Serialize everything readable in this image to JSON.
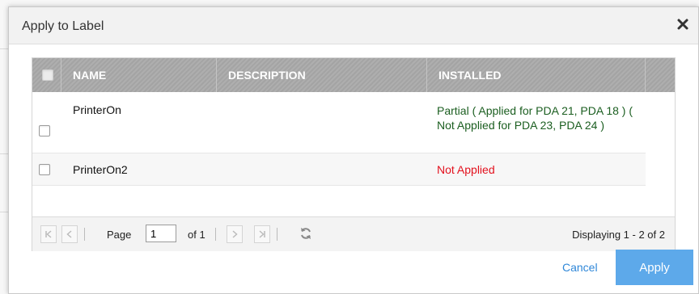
{
  "dialog": {
    "title": "Apply to Label",
    "close_icon": "close-icon"
  },
  "grid": {
    "columns": [
      "NAME",
      "DESCRIPTION",
      "INSTALLED"
    ],
    "rows": [
      {
        "name": "PrinterOn",
        "description": "",
        "installed": "Partial ( Applied for PDA 21, PDA 18 ) ( Not Applied for PDA 23, PDA 24 )",
        "installed_color": "#1b5e20",
        "checked": false
      },
      {
        "name": "PrinterOn2",
        "description": "",
        "installed": "Not Applied",
        "installed_color": "#e3101d",
        "checked": false
      }
    ]
  },
  "pager": {
    "page_label": "Page",
    "page_value": "1",
    "of_label": "of 1",
    "displaying": "Displaying 1 - 2 of 2",
    "icons": [
      "first-page-icon",
      "prev-page-icon",
      "next-page-icon",
      "last-page-icon",
      "refresh-icon"
    ]
  },
  "actions": {
    "cancel": "Cancel",
    "apply": "Apply"
  },
  "colors": {
    "header_bg": "#a9a9a9",
    "apply_bg": "#5da9ea",
    "link": "#2f87d8"
  }
}
